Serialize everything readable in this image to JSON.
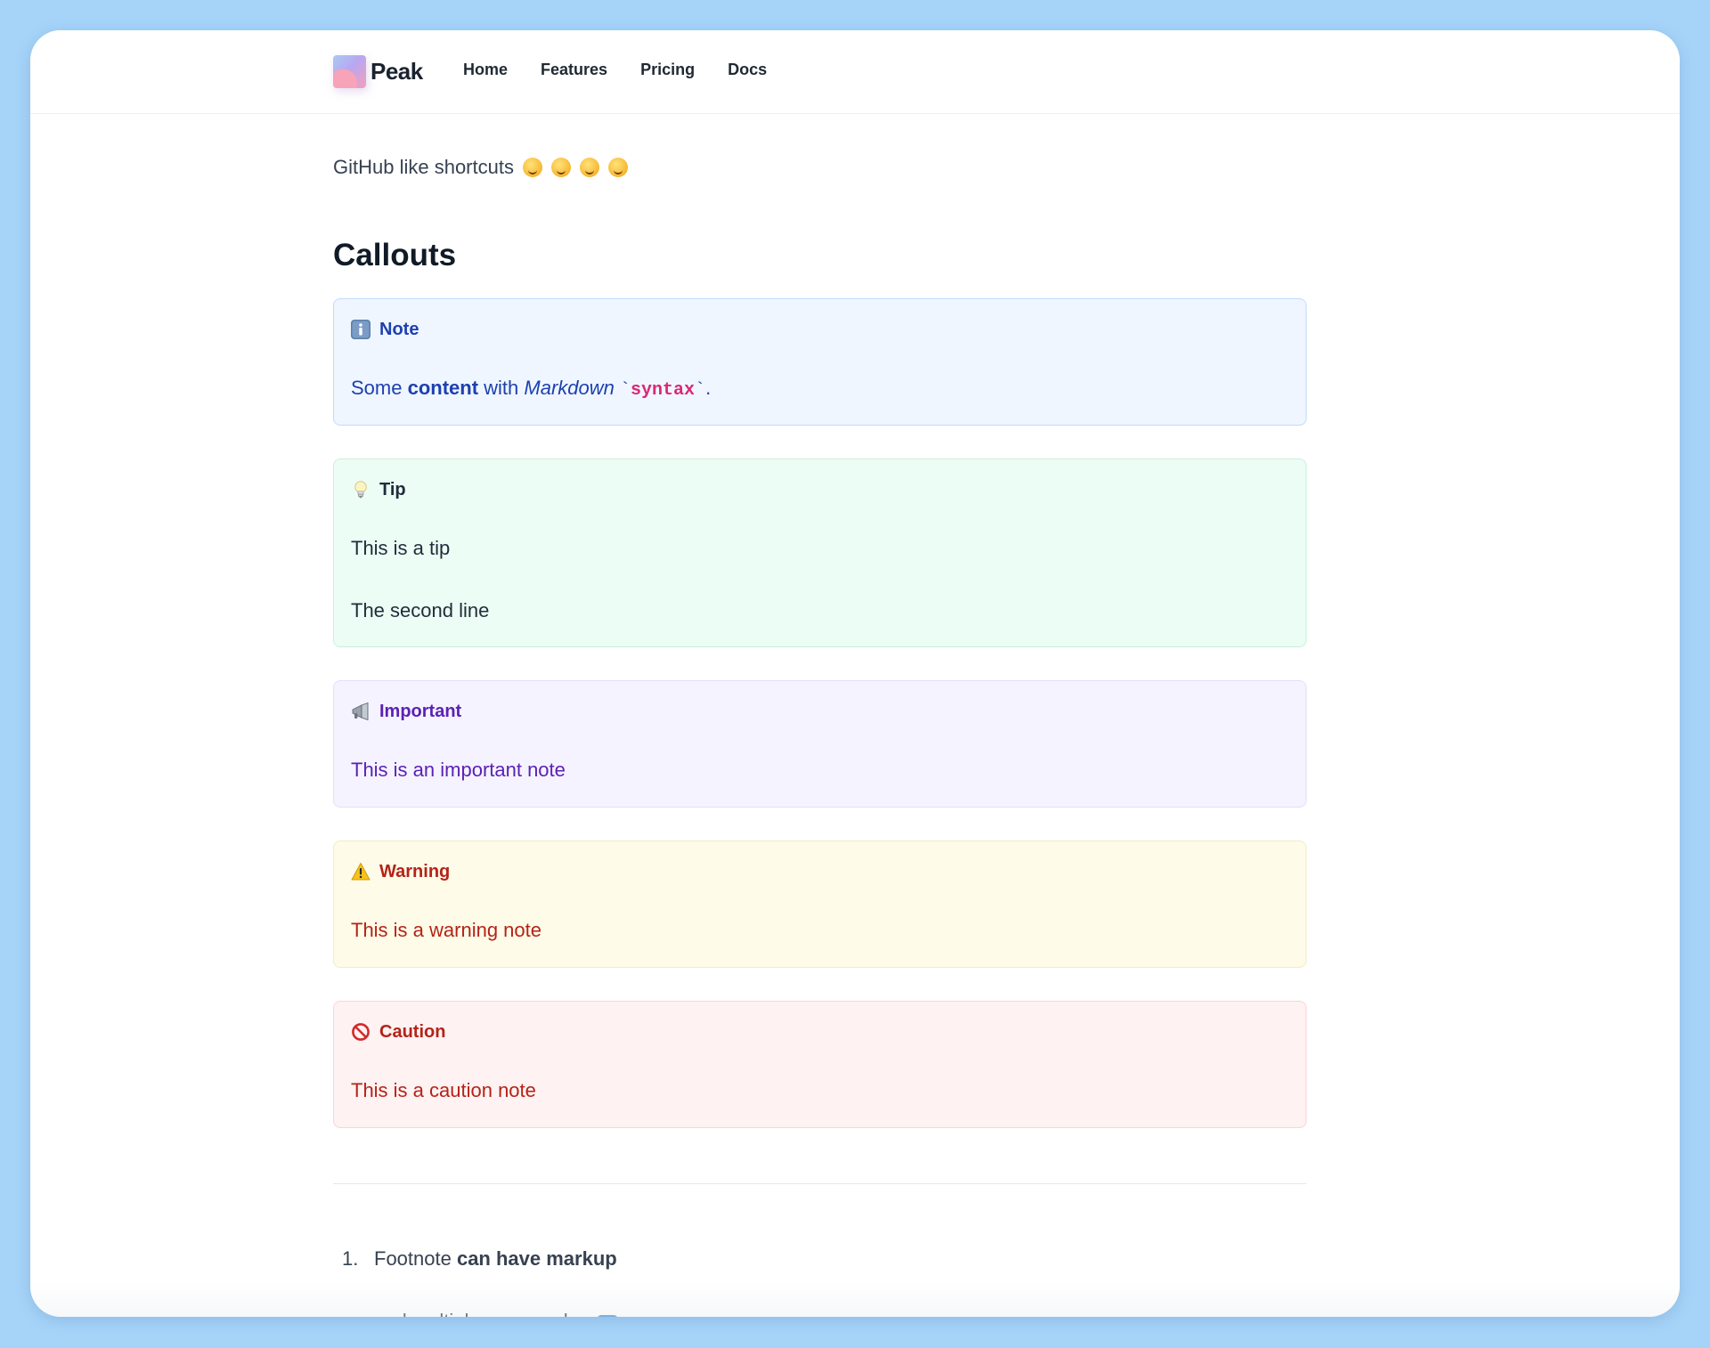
{
  "brand": {
    "name": "Peak"
  },
  "nav": {
    "items": [
      {
        "label": "Home"
      },
      {
        "label": "Features"
      },
      {
        "label": "Pricing"
      },
      {
        "label": "Docs"
      }
    ]
  },
  "intro": {
    "text": "GitHub like shortcuts",
    "emojis": [
      "wink-emoji",
      "dizzy-emoji",
      "grin-emoji",
      "yum-emoji"
    ]
  },
  "section": {
    "title": "Callouts"
  },
  "callouts": {
    "note": {
      "title": "Note",
      "icon": "info-icon",
      "text_before": "Some ",
      "bold": "content",
      "text_mid": " with ",
      "italic": "Markdown",
      "code": "syntax",
      "text_after": ".",
      "color": "#1e40af"
    },
    "tip": {
      "title": "Tip",
      "icon": "lightbulb-icon",
      "lines": [
        "This is a tip",
        "The second line"
      ],
      "color": "#1f2d3a"
    },
    "important": {
      "title": "Important",
      "icon": "megaphone-icon",
      "text": "This is an important note",
      "color": "#5b21b6"
    },
    "warning": {
      "title": "Warning",
      "icon": "warning-triangle-icon",
      "text": "This is a warning note",
      "color": "#b42318"
    },
    "caution": {
      "title": "Caution",
      "icon": "no-entry-icon",
      "text": "This is a caution note",
      "color": "#b42318"
    }
  },
  "footnotes": {
    "items": [
      {
        "number": "1.",
        "text_before": "Footnote ",
        "bold": "can have markup",
        "second_paragraph": "and multiple paragraphs.",
        "backref_icon": "return-arrow-icon"
      }
    ]
  }
}
